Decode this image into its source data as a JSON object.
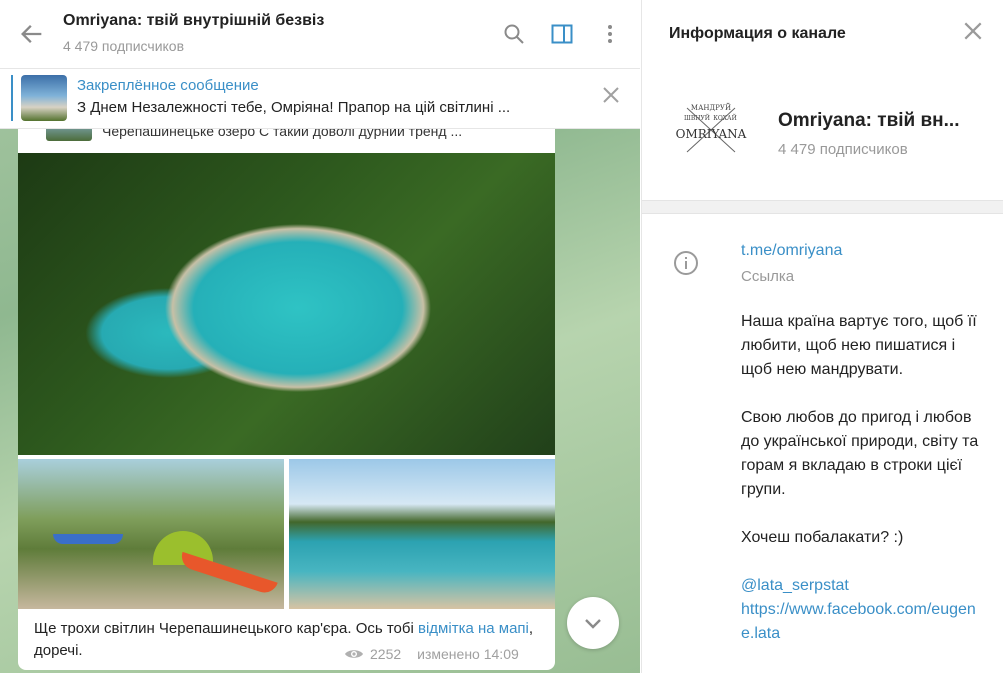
{
  "chat": {
    "title": "Omriyana: твій внутрішній безвіз",
    "subscribers": "4 479 подписчиков",
    "pinned": {
      "title": "Закреплённое сообщение",
      "text": "З Днем Незалежності тебе, Омріяна!  Прапор на цій світлині ..."
    },
    "prev_snippet": "Черепашинецьке озеро  С такий доволі дурний тренд ...",
    "message": {
      "text_before": "Ще трохи світлин Черепашинецького кар'єра. Ось тобі ",
      "link_text": "відмітка на мапі",
      "text_after": ", доречі.",
      "views": "2252",
      "edited": "изменено 14:09"
    }
  },
  "info_panel": {
    "title": "Информация о канале",
    "channel_name": "Omriyana: твій вн...",
    "subscribers": "4 479 подписчиков",
    "avatar_text_top": "МАНДРУЙ",
    "avatar_text_mid_left": "ШВНУЙ",
    "avatar_text_mid_right": "КОХАЙ",
    "avatar_text_main": "OMRIYANA",
    "link": "t.me/omriyana",
    "link_label": "Ссылка",
    "description": [
      "Наша країна вартує того, щоб її любити, щоб нею пишатися і щоб нею мандрувати.",
      "Свою любов до пригод і любов до української природи, світу та горам я вкладаю в строки цієї групи.",
      "Хочеш побалакати? :)"
    ],
    "contact_handle": "@lata_serpstat",
    "contact_url": "https://www.facebook.com/eugene.lata"
  },
  "icons": {
    "back": "arrow-left-icon",
    "search": "search-icon",
    "sidebar": "sidebar-toggle-icon",
    "more": "more-vertical-icon",
    "close": "close-icon",
    "info": "info-icon",
    "eye": "eye-icon",
    "chevron": "chevron-down-icon"
  },
  "colors": {
    "accent": "#3a8fc7",
    "text": "#222222",
    "muted": "#999999"
  }
}
